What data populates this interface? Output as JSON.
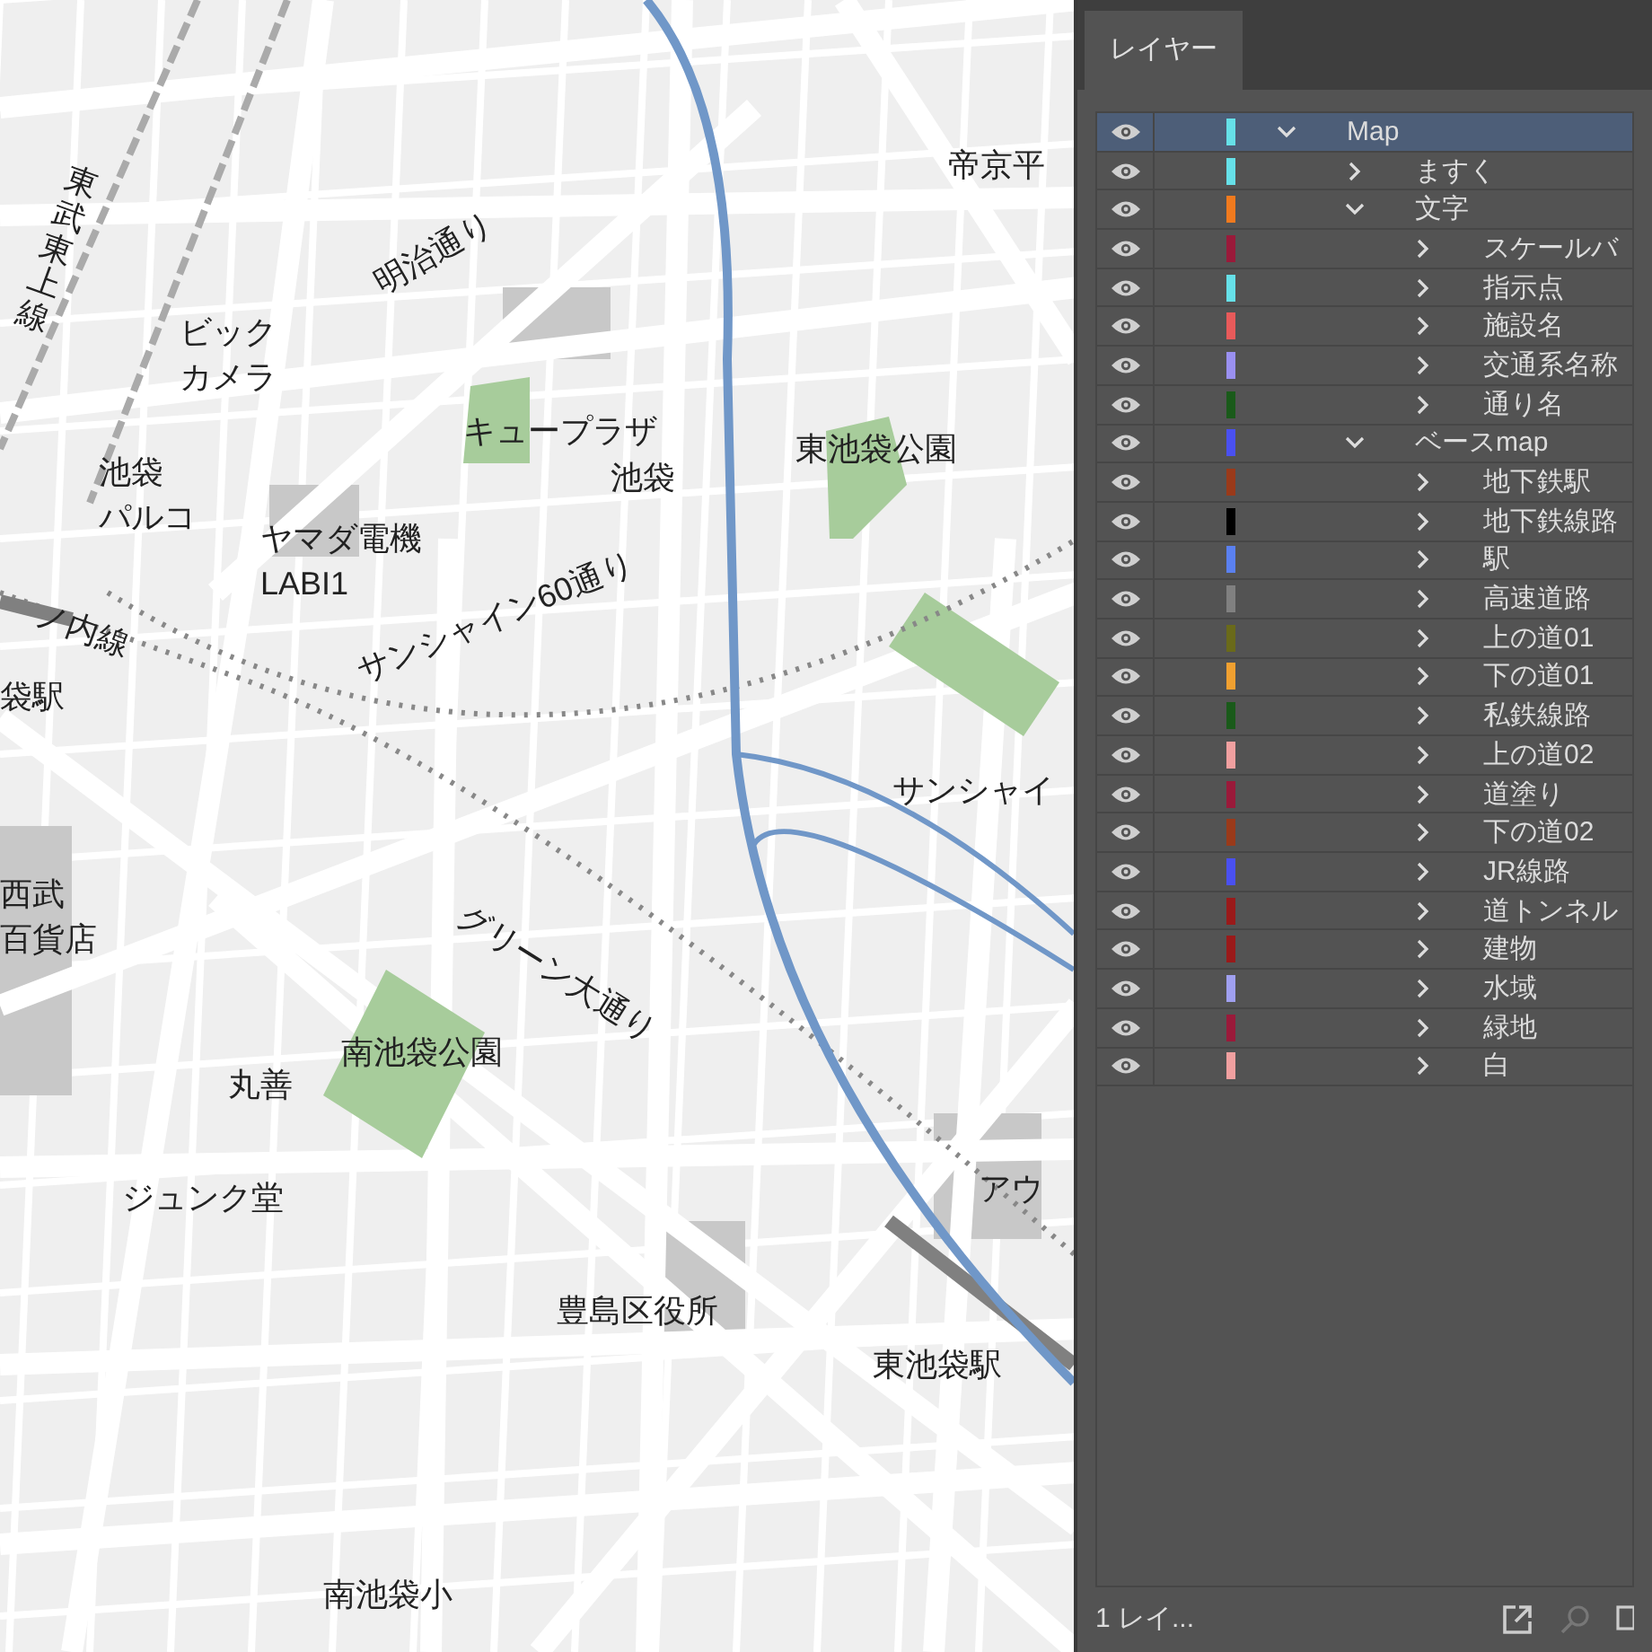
{
  "map": {
    "labels": [
      {
        "text": "帝京平"
      },
      {
        "text": "明治通り"
      },
      {
        "text": "ビック"
      },
      {
        "text": "カメラ"
      },
      {
        "text": "キュープラザ"
      },
      {
        "text": "池袋"
      },
      {
        "text": "東池袋公園"
      },
      {
        "text": "池袋"
      },
      {
        "text": "パルコ"
      },
      {
        "text": "ヤマダ電機"
      },
      {
        "text": "LABI1"
      },
      {
        "text": "ノ内線"
      },
      {
        "text": "袋駅"
      },
      {
        "text": "サンシャイン60通り"
      },
      {
        "text": "サンシャイ"
      },
      {
        "text": "グリーン大通り"
      },
      {
        "text": "西武"
      },
      {
        "text": "百貨店"
      },
      {
        "text": "南池袋公園"
      },
      {
        "text": "丸善"
      },
      {
        "text": "ジュンク堂"
      },
      {
        "text": "アウ"
      },
      {
        "text": "豊島区役所"
      },
      {
        "text": "東池袋駅"
      },
      {
        "text": "南池袋小"
      },
      {
        "text": "東武東上線"
      }
    ]
  },
  "layers_panel": {
    "tab": "レイヤー",
    "footer": "1 レイ...",
    "layers": [
      {
        "name": "Map",
        "color": "#66e0e8",
        "expanded": true,
        "selected": true,
        "children": [
          {
            "name": "ますく",
            "color": "#66e0e8",
            "expanded": false,
            "selected": false
          },
          {
            "name": "文字",
            "color": "#f07a1e",
            "expanded": true,
            "selected": false,
            "children": [
              {
                "name": "スケールバ",
                "color": "#9a1a3a",
                "expanded": false,
                "selected": false
              },
              {
                "name": "指示点",
                "color": "#66e0e8",
                "expanded": false,
                "selected": false
              },
              {
                "name": "施設名",
                "color": "#e85a5a",
                "expanded": false,
                "selected": false
              },
              {
                "name": "交通系名称",
                "color": "#9a90f0",
                "expanded": false,
                "selected": false
              },
              {
                "name": "通り名",
                "color": "#1a5a1a",
                "expanded": false,
                "selected": false
              }
            ]
          },
          {
            "name": "ベースmap",
            "color": "#4a50f0",
            "expanded": true,
            "selected": false,
            "children": [
              {
                "name": "地下鉄駅",
                "color": "#9a3a1a",
                "expanded": false,
                "selected": false
              },
              {
                "name": "地下鉄線路",
                "color": "#000000",
                "expanded": false,
                "selected": false
              },
              {
                "name": "駅",
                "color": "#5a80f0",
                "expanded": false,
                "selected": false
              },
              {
                "name": "高速道路",
                "color": "#808080",
                "expanded": false,
                "selected": false
              },
              {
                "name": "上の道01",
                "color": "#6a6a1a",
                "expanded": false,
                "selected": false
              },
              {
                "name": "下の道01",
                "color": "#f0a030",
                "expanded": false,
                "selected": false
              },
              {
                "name": "私鉄線路",
                "color": "#1a5a1a",
                "expanded": false,
                "selected": false
              },
              {
                "name": "上の道02",
                "color": "#f0a0a0",
                "expanded": false,
                "selected": false
              },
              {
                "name": "道塗り",
                "color": "#9a1a3a",
                "expanded": false,
                "selected": false
              },
              {
                "name": "下の道02",
                "color": "#9a3a1a",
                "expanded": false,
                "selected": false
              },
              {
                "name": "JR線路",
                "color": "#4a50f0",
                "expanded": false,
                "selected": false
              },
              {
                "name": "道トンネル",
                "color": "#9a1a1a",
                "expanded": false,
                "selected": false
              },
              {
                "name": "建物",
                "color": "#9a1a1a",
                "expanded": false,
                "selected": false
              },
              {
                "name": "水域",
                "color": "#a0a0f0",
                "expanded": false,
                "selected": false
              },
              {
                "name": "緑地",
                "color": "#9a1a3a",
                "expanded": false,
                "selected": false
              },
              {
                "name": "白",
                "color": "#f0a0a0",
                "expanded": false,
                "selected": false
              }
            ]
          }
        ]
      }
    ]
  }
}
